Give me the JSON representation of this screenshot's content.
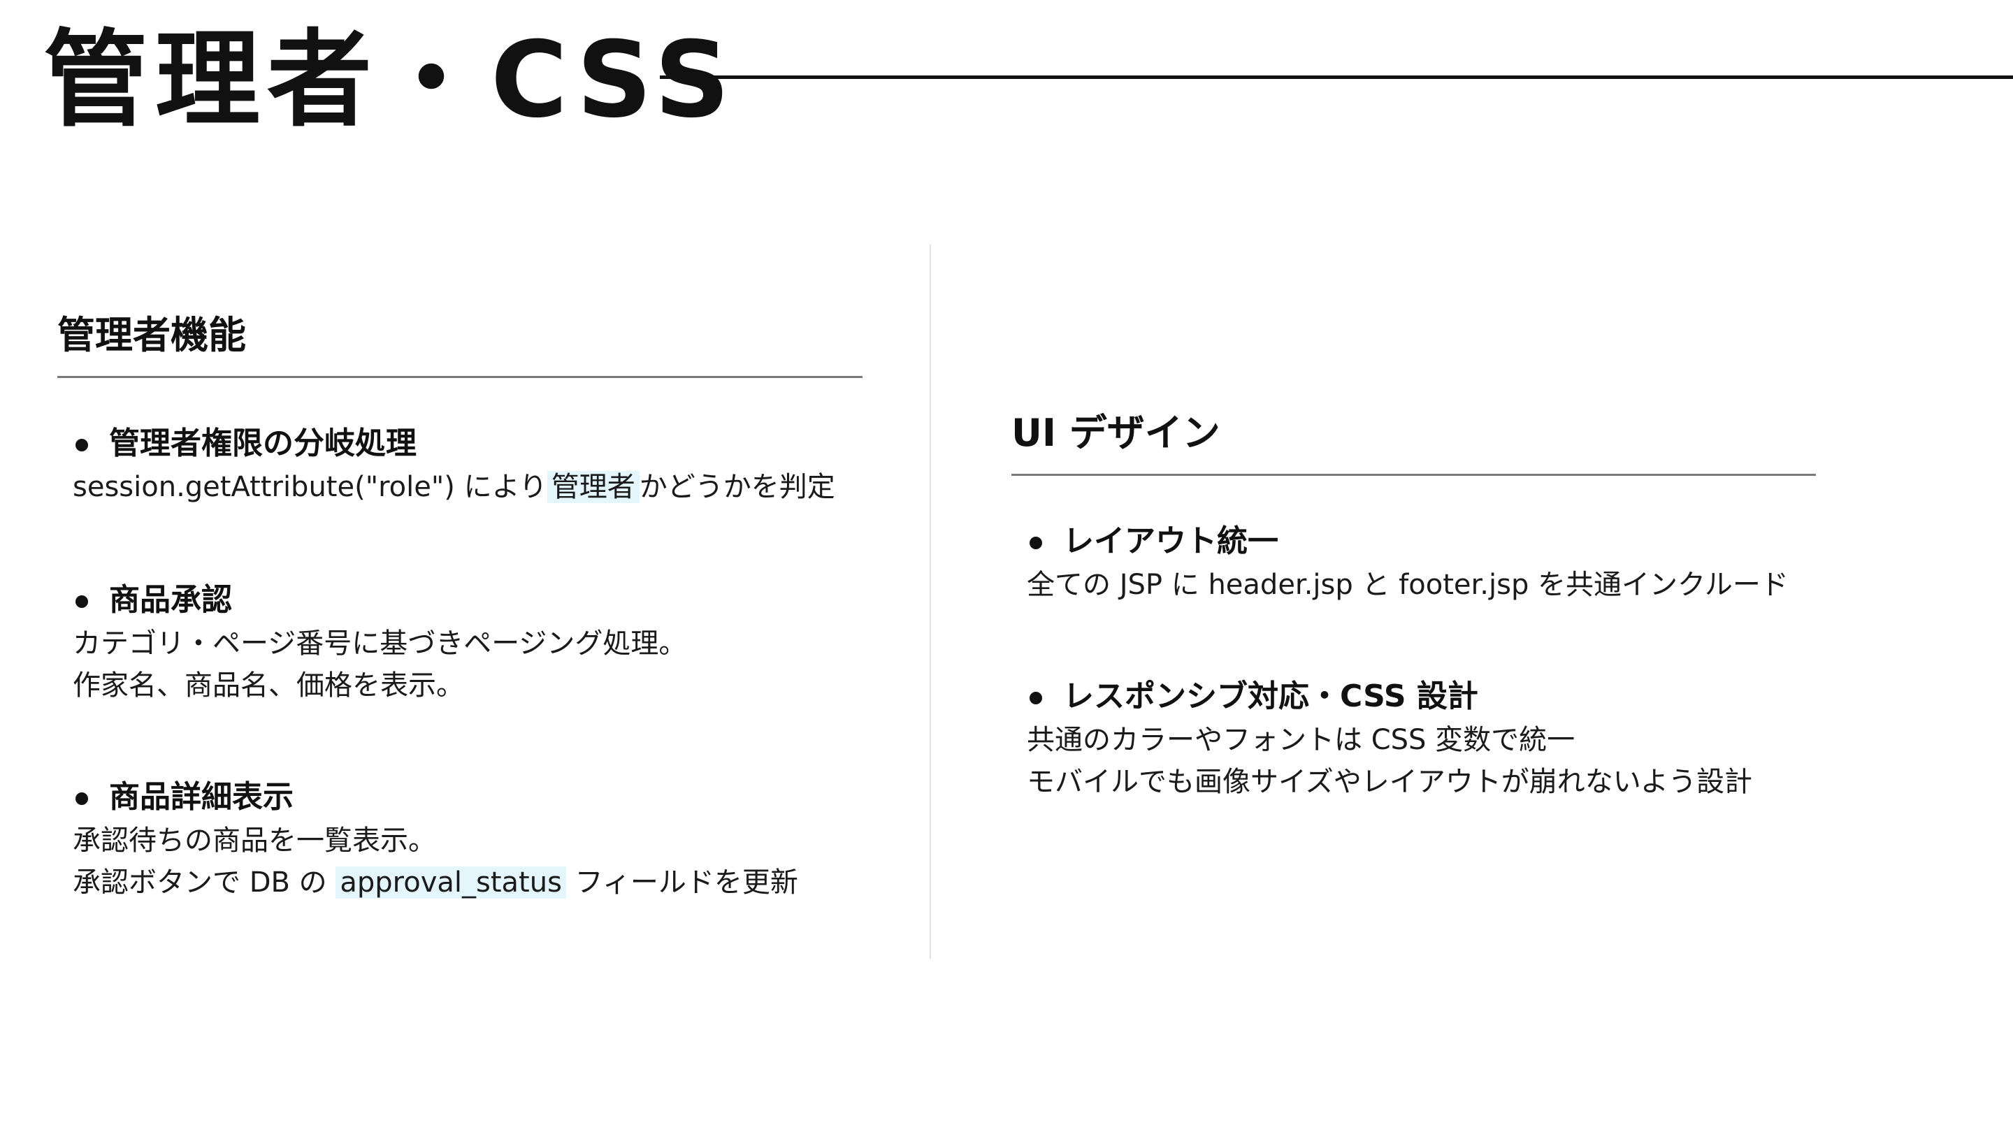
{
  "title": "管理者・CSS",
  "admin_section": {
    "heading": "管理者機能",
    "items": [
      {
        "title": "管理者権限の分岐処理",
        "line1_pre": "session.getAttribute(\"role\") により",
        "line1_highlight": "管理者",
        "line1_post": "かどうかを判定"
      },
      {
        "title": "商品承認",
        "line1": "カテゴリ・ページ番号に基づきページング処理。",
        "line2": "作家名、商品名、価格を表示。"
      },
      {
        "title": "商品詳細表示",
        "line1": "承認待ちの商品を一覧表示。",
        "line2_pre": "承認ボタンで DB の ",
        "line2_highlight": "approval_status",
        "line2_post": " フィールドを更新"
      }
    ]
  },
  "ui_section": {
    "heading": "UI デザイン",
    "items": [
      {
        "title": "レイアウト統一",
        "line1": "全ての JSP に header.jsp と footer.jsp を共通インクルード"
      },
      {
        "title": "レスポンシブ対応・CSS 設計",
        "line1": "共通のカラーやフォントは CSS 変数で統一",
        "line2": "モバイルでも画像サイズやレイアウトが崩れないよう設計"
      }
    ]
  },
  "colors": {
    "text": "#111111",
    "highlight": "#e4f5fb",
    "section_rule": "#7a7a7a",
    "column_divider": "#e2e2e2"
  }
}
